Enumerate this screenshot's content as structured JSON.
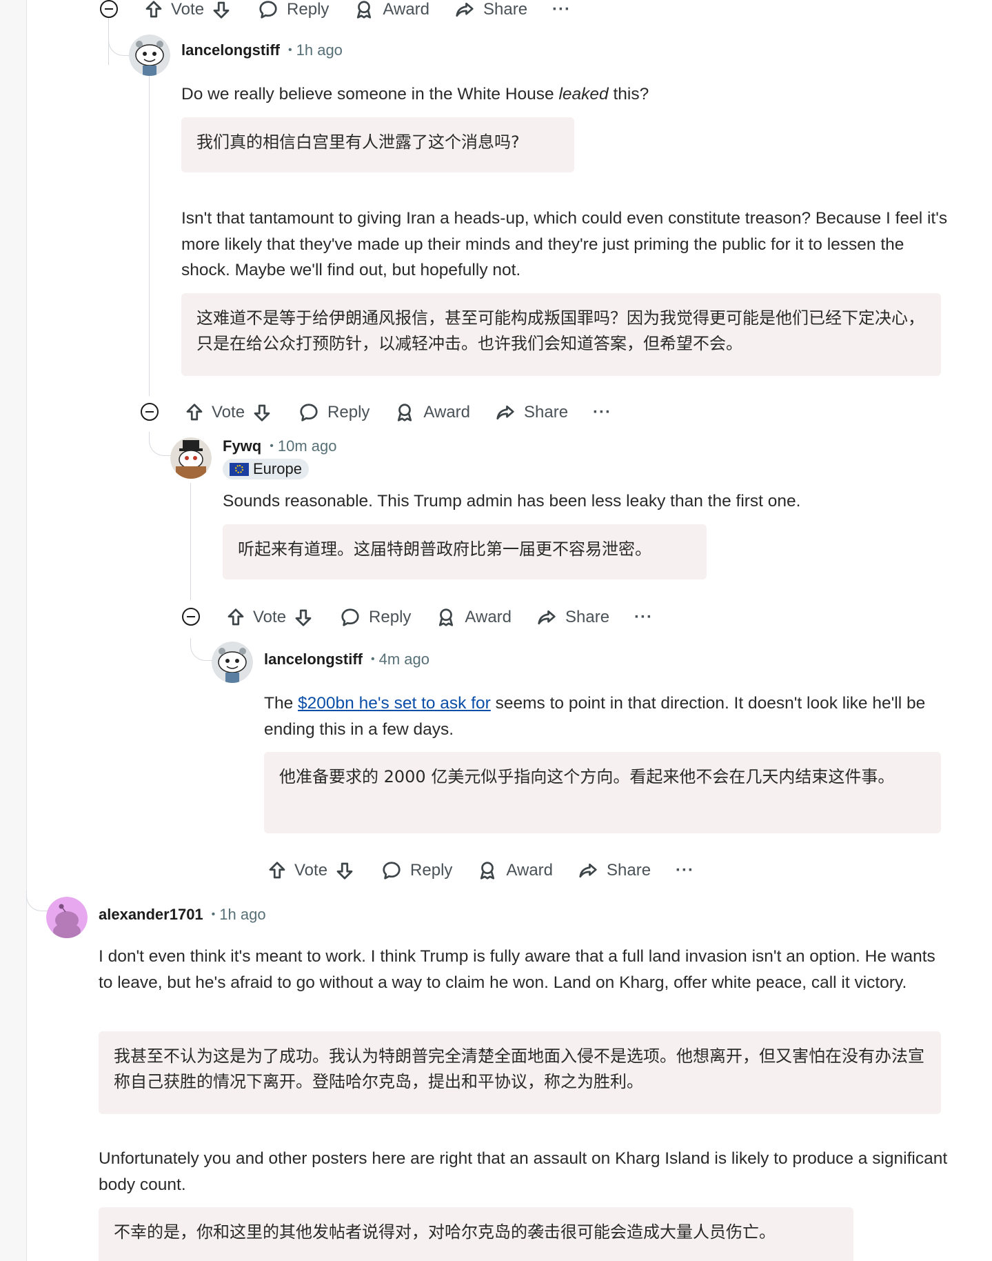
{
  "actions": {
    "vote": "Vote",
    "reply": "Reply",
    "award": "Award",
    "share": "Share",
    "more": "···"
  },
  "comments": [
    {
      "username": "lancelongstiff",
      "time": "1h ago",
      "avatar": "snoo-avatar",
      "paragraphs": [
        {
          "pre": "Do we really believe someone in the White House ",
          "em": "leaked",
          "post": " this?",
          "translation": "我们真的相信白宫里有人泄露了这个消息吗?"
        },
        {
          "text": "Isn't that tantamount to giving Iran a heads-up, which could even constitute treason? Because I feel it's more likely that they've made up their minds and they're just priming the public for it to lessen the shock. Maybe we'll find out, but hopefully not.",
          "translation": "这难道不是等于给伊朗通风报信，甚至可能构成叛国罪吗？因为我觉得更可能是他们已经下定决心，只是在给公众打预防针，以减轻冲击。也许我们会知道答案，但希望不会。"
        }
      ]
    },
    {
      "username": "Fywq",
      "time": "10m ago",
      "flair": "Europe",
      "avatar": "snoo-avatar-tophat",
      "paragraphs": [
        {
          "text": "Sounds reasonable. This Trump admin has been less leaky than the first one.",
          "translation": "听起来有道理。这届特朗普政府比第一届更不容易泄密。"
        }
      ]
    },
    {
      "username": "lancelongstiff",
      "time": "4m ago",
      "avatar": "snoo-avatar",
      "paragraphs": [
        {
          "pre": "The ",
          "link": "$200bn he's set to ask for",
          "post": " seems to point in that direction. It doesn't look like he'll be ending this in a few days.",
          "translation": "他准备要求的 2000 亿美元似乎指向这个方向。看起来他不会在几天内结束这件事。"
        }
      ]
    },
    {
      "username": "alexander1701",
      "time": "1h ago",
      "avatar": "snoo-avatar-purple",
      "paragraphs": [
        {
          "text": "I don't even think it's meant to work. I think Trump is fully aware that a full land invasion isn't an option. He wants to leave, but he's afraid to go without a way to claim he won. Land on Kharg, offer white peace, call it victory.",
          "translation": "我甚至不认为这是为了成功。我认为特朗普完全清楚全面地面入侵不是选项。他想离开，但又害怕在没有办法宣称自己获胜的情况下离开。登陆哈尔克岛，提出和平协议，称之为胜利。"
        },
        {
          "text": "Unfortunately you and other posters here are right that an assault on Kharg Island is likely to produce a significant body count.",
          "translation": "不幸的是，你和这里的其他发帖者说得对，对哈尔克岛的袭击很可能会造成大量人员伤亡。"
        }
      ]
    }
  ]
}
